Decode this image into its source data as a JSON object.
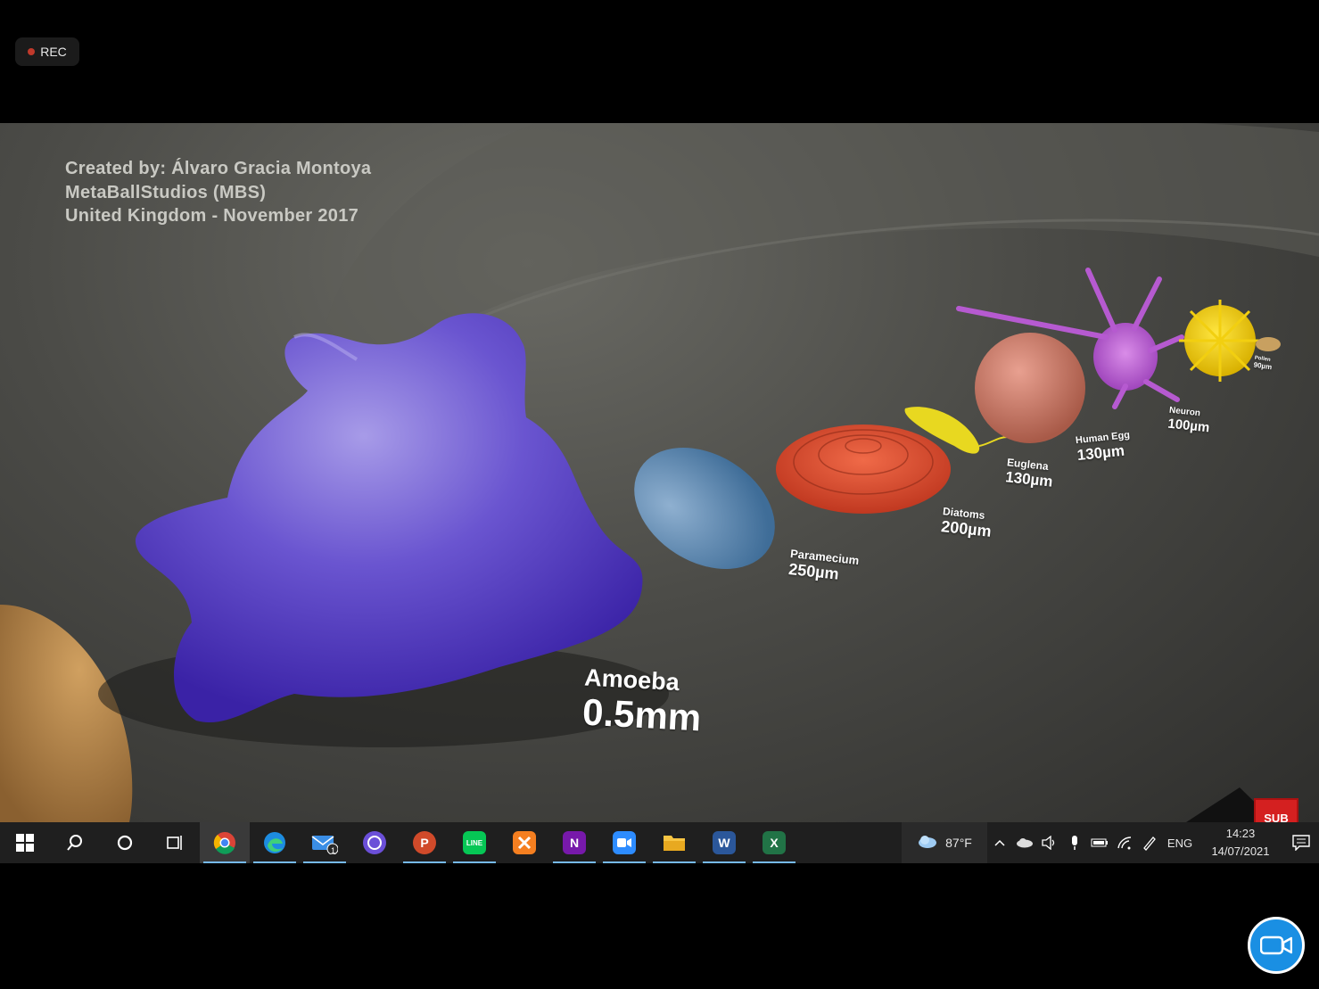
{
  "recording": {
    "label": "REC"
  },
  "video": {
    "credits": [
      "Created by: Álvaro Gracia Montoya",
      "MetaBallStudios (MBS)",
      "United Kingdom - November 2017"
    ],
    "items": [
      {
        "name": "Amoeba",
        "size": "0.5mm"
      },
      {
        "name": "Paramecium",
        "size": "250µm"
      },
      {
        "name": "Diatoms",
        "size": "200µm"
      },
      {
        "name": "Euglena",
        "size": "130µm"
      },
      {
        "name": "Human Egg",
        "size": "130µm"
      },
      {
        "name": "Neuron",
        "size": "100µm"
      },
      {
        "name": "Pollen",
        "size": "90µm"
      }
    ],
    "badge": "SUB"
  },
  "taskbar": {
    "apps": [
      {
        "name": "chrome",
        "active": true
      },
      {
        "name": "edge"
      },
      {
        "name": "mail",
        "badge": "1"
      },
      {
        "name": "cortana-app"
      },
      {
        "name": "powerpoint",
        "letter": "P"
      },
      {
        "name": "line",
        "letter": "LINE"
      },
      {
        "name": "xampp"
      },
      {
        "name": "onenote",
        "letter": "N"
      },
      {
        "name": "zoom"
      },
      {
        "name": "file-explorer"
      },
      {
        "name": "word",
        "letter": "W"
      },
      {
        "name": "excel",
        "letter": "X"
      }
    ],
    "weather": "87°F",
    "language": "ENG",
    "time": "14:23",
    "date": "14/07/2021"
  },
  "colors": {
    "taskbar": "#1f1f1f",
    "accent": "#76b9ed",
    "camera": "#1a8fe3",
    "rec_dot": "#c0392b"
  }
}
